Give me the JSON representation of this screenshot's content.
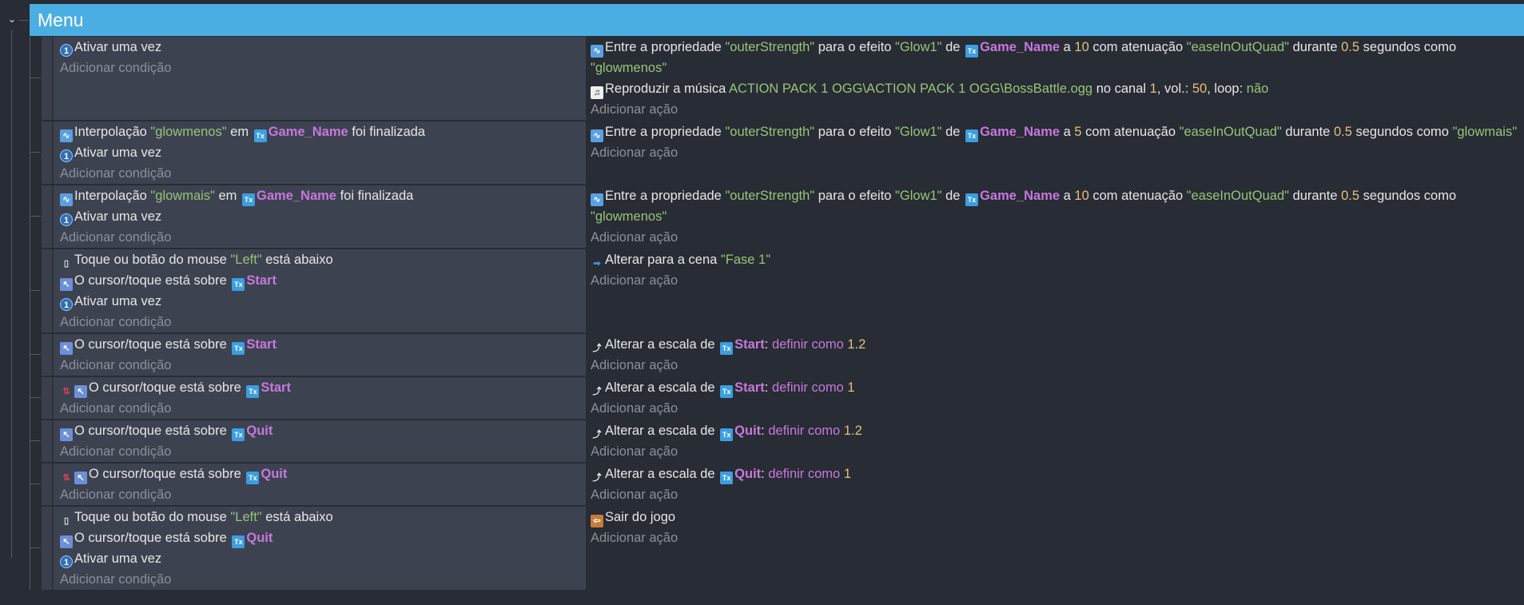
{
  "group": {
    "title": "Menu"
  },
  "labels": {
    "add_condition": "Adicionar condição",
    "add_action": "Adicionar ação"
  },
  "colors": {
    "header": "#4aaee2",
    "string": "#98c379",
    "number": "#e5c07b",
    "object": "#c678dd"
  },
  "events": [
    {
      "conditions": [
        {
          "icon": "trigger-once",
          "segs": [
            [
              "Ativar uma vez",
              "p"
            ]
          ]
        }
      ],
      "actions": [
        {
          "icon": "tween",
          "segs": [
            [
              "Entre a propriedade ",
              "p"
            ],
            [
              "\"outerStrength\"",
              "s"
            ],
            [
              " para o efeito ",
              "p"
            ],
            [
              "\"Glow1\"",
              "s"
            ],
            [
              " de ",
              "p"
            ],
            [
              "Game_Name",
              "o"
            ],
            [
              " a ",
              "p"
            ],
            [
              "10",
              "n"
            ],
            [
              " com atenuação ",
              "p"
            ],
            [
              "\"easeInOutQuad\"",
              "s"
            ],
            [
              " durante ",
              "p"
            ],
            [
              "0.5",
              "n"
            ],
            [
              " segundos como ",
              "p"
            ],
            [
              "\"glowmenos\"",
              "s"
            ]
          ]
        },
        {
          "icon": "music",
          "segs": [
            [
              "Reproduzir a música ",
              "p"
            ],
            [
              "ACTION PACK 1 OGG\\ACTION PACK 1 OGG\\BossBattle.ogg",
              "s"
            ],
            [
              " no canal ",
              "p"
            ],
            [
              "1",
              "n"
            ],
            [
              ", vol.: ",
              "p"
            ],
            [
              "50",
              "n"
            ],
            [
              ", loop: ",
              "p"
            ],
            [
              "não",
              "s"
            ]
          ]
        }
      ]
    },
    {
      "conditions": [
        {
          "icon": "tween",
          "segs": [
            [
              "Interpolação ",
              "p"
            ],
            [
              "\"glowmenos\"",
              "s"
            ],
            [
              " em ",
              "p"
            ],
            [
              "Game_Name",
              "o"
            ],
            [
              " foi finalizada",
              "p"
            ]
          ]
        },
        {
          "icon": "trigger-once",
          "segs": [
            [
              "Ativar uma vez",
              "p"
            ]
          ]
        }
      ],
      "actions": [
        {
          "icon": "tween",
          "segs": [
            [
              "Entre a propriedade ",
              "p"
            ],
            [
              "\"outerStrength\"",
              "s"
            ],
            [
              " para o efeito ",
              "p"
            ],
            [
              "\"Glow1\"",
              "s"
            ],
            [
              " de ",
              "p"
            ],
            [
              "Game_Name",
              "o"
            ],
            [
              " a ",
              "p"
            ],
            [
              "5",
              "n"
            ],
            [
              " com atenuação ",
              "p"
            ],
            [
              "\"easeInOutQuad\"",
              "s"
            ],
            [
              " durante ",
              "p"
            ],
            [
              "0.5",
              "n"
            ],
            [
              " segundos como ",
              "p"
            ],
            [
              "\"glowmais\"",
              "s"
            ]
          ]
        }
      ]
    },
    {
      "conditions": [
        {
          "icon": "tween",
          "segs": [
            [
              "Interpolação ",
              "p"
            ],
            [
              "\"glowmais\"",
              "s"
            ],
            [
              " em ",
              "p"
            ],
            [
              "Game_Name",
              "o"
            ],
            [
              " foi finalizada",
              "p"
            ]
          ]
        },
        {
          "icon": "trigger-once",
          "segs": [
            [
              "Ativar uma vez",
              "p"
            ]
          ]
        }
      ],
      "actions": [
        {
          "icon": "tween",
          "segs": [
            [
              "Entre a propriedade ",
              "p"
            ],
            [
              "\"outerStrength\"",
              "s"
            ],
            [
              " para o efeito ",
              "p"
            ],
            [
              "\"Glow1\"",
              "s"
            ],
            [
              " de ",
              "p"
            ],
            [
              "Game_Name",
              "o"
            ],
            [
              " a ",
              "p"
            ],
            [
              "10",
              "n"
            ],
            [
              " com atenuação ",
              "p"
            ],
            [
              "\"easeInOutQuad\"",
              "s"
            ],
            [
              " durante ",
              "p"
            ],
            [
              "0.5",
              "n"
            ],
            [
              " segundos como ",
              "p"
            ],
            [
              "\"glowmenos\"",
              "s"
            ]
          ]
        }
      ]
    },
    {
      "conditions": [
        {
          "icon": "mouse",
          "segs": [
            [
              "Toque ou botão do mouse ",
              "p"
            ],
            [
              "\"Left\"",
              "s"
            ],
            [
              " está abaixo",
              "p"
            ]
          ]
        },
        {
          "icon": "cursor",
          "segs": [
            [
              "O cursor/toque está sobre ",
              "p"
            ],
            [
              "Start",
              "o"
            ]
          ]
        },
        {
          "icon": "trigger-once",
          "segs": [
            [
              "Ativar uma vez",
              "p"
            ]
          ]
        }
      ],
      "actions": [
        {
          "icon": "scene",
          "segs": [
            [
              "Alterar para a cena ",
              "p"
            ],
            [
              "\"Fase 1\"",
              "s"
            ]
          ]
        }
      ]
    },
    {
      "conditions": [
        {
          "icon": "cursor",
          "segs": [
            [
              "O cursor/toque está sobre ",
              "p"
            ],
            [
              "Start",
              "o"
            ]
          ]
        }
      ],
      "actions": [
        {
          "icon": "scale",
          "segs": [
            [
              "Alterar a escala de ",
              "p"
            ],
            [
              "Start",
              "o"
            ],
            [
              ": ",
              "p"
            ],
            [
              "definir como ",
              "v"
            ],
            [
              "1.2",
              "n"
            ]
          ]
        }
      ]
    },
    {
      "conditions": [
        {
          "icon": "cursor",
          "inverted": true,
          "segs": [
            [
              "O cursor/toque está sobre ",
              "p"
            ],
            [
              "Start",
              "o"
            ]
          ]
        }
      ],
      "actions": [
        {
          "icon": "scale",
          "segs": [
            [
              "Alterar a escala de ",
              "p"
            ],
            [
              "Start",
              "o"
            ],
            [
              ": ",
              "p"
            ],
            [
              "definir como ",
              "v"
            ],
            [
              "1",
              "n"
            ]
          ]
        }
      ]
    },
    {
      "conditions": [
        {
          "icon": "cursor",
          "segs": [
            [
              "O cursor/toque está sobre ",
              "p"
            ],
            [
              "Quit",
              "o"
            ]
          ]
        }
      ],
      "actions": [
        {
          "icon": "scale",
          "segs": [
            [
              "Alterar a escala de ",
              "p"
            ],
            [
              "Quit",
              "o"
            ],
            [
              ": ",
              "p"
            ],
            [
              "definir como ",
              "v"
            ],
            [
              "1.2",
              "n"
            ]
          ]
        }
      ]
    },
    {
      "conditions": [
        {
          "icon": "cursor",
          "inverted": true,
          "segs": [
            [
              "O cursor/toque está sobre ",
              "p"
            ],
            [
              "Quit",
              "o"
            ]
          ]
        }
      ],
      "actions": [
        {
          "icon": "scale",
          "segs": [
            [
              "Alterar a escala de ",
              "p"
            ],
            [
              "Quit",
              "o"
            ],
            [
              ": ",
              "p"
            ],
            [
              "definir como ",
              "v"
            ],
            [
              "1",
              "n"
            ]
          ]
        }
      ]
    },
    {
      "conditions": [
        {
          "icon": "mouse",
          "segs": [
            [
              "Toque ou botão do mouse ",
              "p"
            ],
            [
              "\"Left\"",
              "s"
            ],
            [
              " está abaixo",
              "p"
            ]
          ]
        },
        {
          "icon": "cursor",
          "segs": [
            [
              "O cursor/toque está sobre ",
              "p"
            ],
            [
              "Quit",
              "o"
            ]
          ]
        },
        {
          "icon": "trigger-once",
          "segs": [
            [
              "Ativar uma vez",
              "p"
            ]
          ]
        }
      ],
      "actions": [
        {
          "icon": "exit",
          "segs": [
            [
              "Sair do jogo",
              "p"
            ]
          ]
        }
      ]
    }
  ]
}
